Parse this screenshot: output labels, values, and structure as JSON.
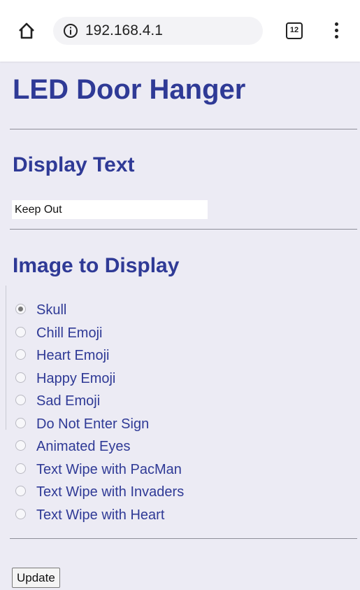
{
  "browser": {
    "url": "192.168.4.1",
    "tab_count": "12",
    "icons": [
      "home-icon",
      "info-icon",
      "tab-switcher-icon",
      "overflow-menu-icon"
    ]
  },
  "page": {
    "title": "LED Door Hanger",
    "display_text": {
      "heading": "Display Text",
      "value": "Keep Out"
    },
    "image": {
      "heading": "Image to Display",
      "selected": "Skull",
      "options": [
        {
          "label": "Skull",
          "checked": true
        },
        {
          "label": "Chill Emoji",
          "checked": false
        },
        {
          "label": "Heart Emoji",
          "checked": false
        },
        {
          "label": "Happy Emoji",
          "checked": false
        },
        {
          "label": "Sad Emoji",
          "checked": false
        },
        {
          "label": "Do Not Enter Sign",
          "checked": false
        },
        {
          "label": "Animated Eyes",
          "checked": false
        },
        {
          "label": "Text Wipe with PacMan",
          "checked": false
        },
        {
          "label": "Text Wipe with Invaders",
          "checked": false
        },
        {
          "label": "Text Wipe with Heart",
          "checked": false
        }
      ]
    },
    "update_label": "Update"
  },
  "colors": {
    "heading": "#2f3a96",
    "background": "#ecebf4"
  }
}
